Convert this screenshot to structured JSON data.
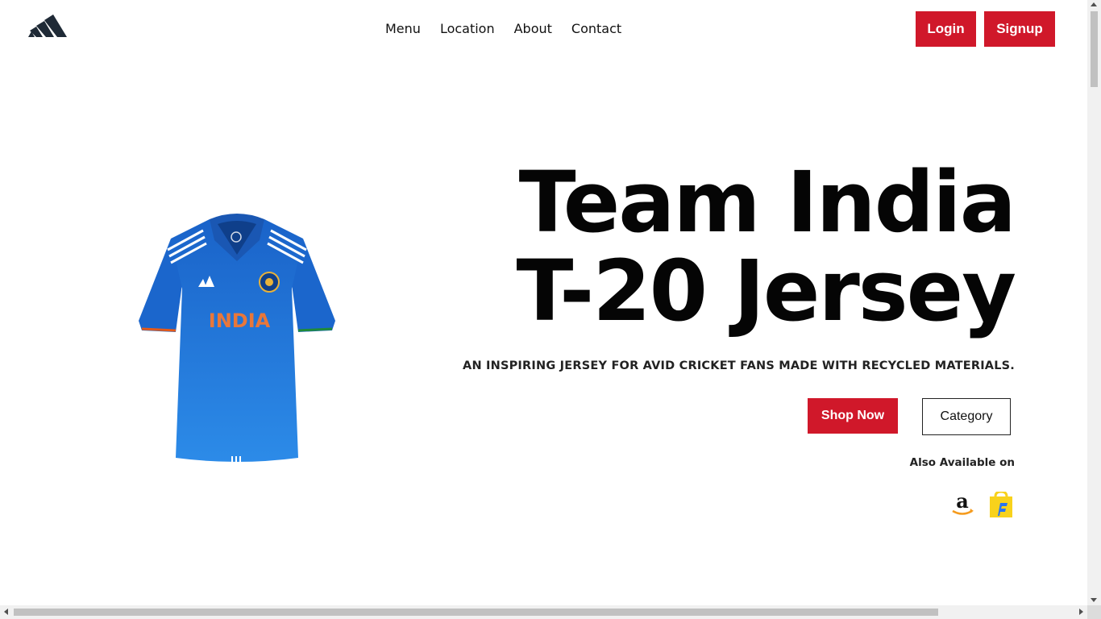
{
  "header": {
    "logo_icon": "adidas-logo-icon",
    "nav": [
      "Menu",
      "Location",
      "About",
      "Contact"
    ],
    "login_label": "Login",
    "signup_label": "Signup"
  },
  "hero": {
    "title_line1": "Team India",
    "title_line2": "T-20 Jersey",
    "subtitle": "AN INSPIRING JERSEY FOR AVID CRICKET FANS MADE WITH RECYCLED MATERIALS.",
    "shop_label": "Shop Now",
    "category_label": "Category",
    "also_label": "Also Available on",
    "jersey_text": "INDIA",
    "stores": [
      "amazon-icon",
      "flipkart-icon"
    ]
  },
  "colors": {
    "accent": "#d0182a",
    "jersey_blue": "#1e72d6",
    "text": "#111111"
  }
}
